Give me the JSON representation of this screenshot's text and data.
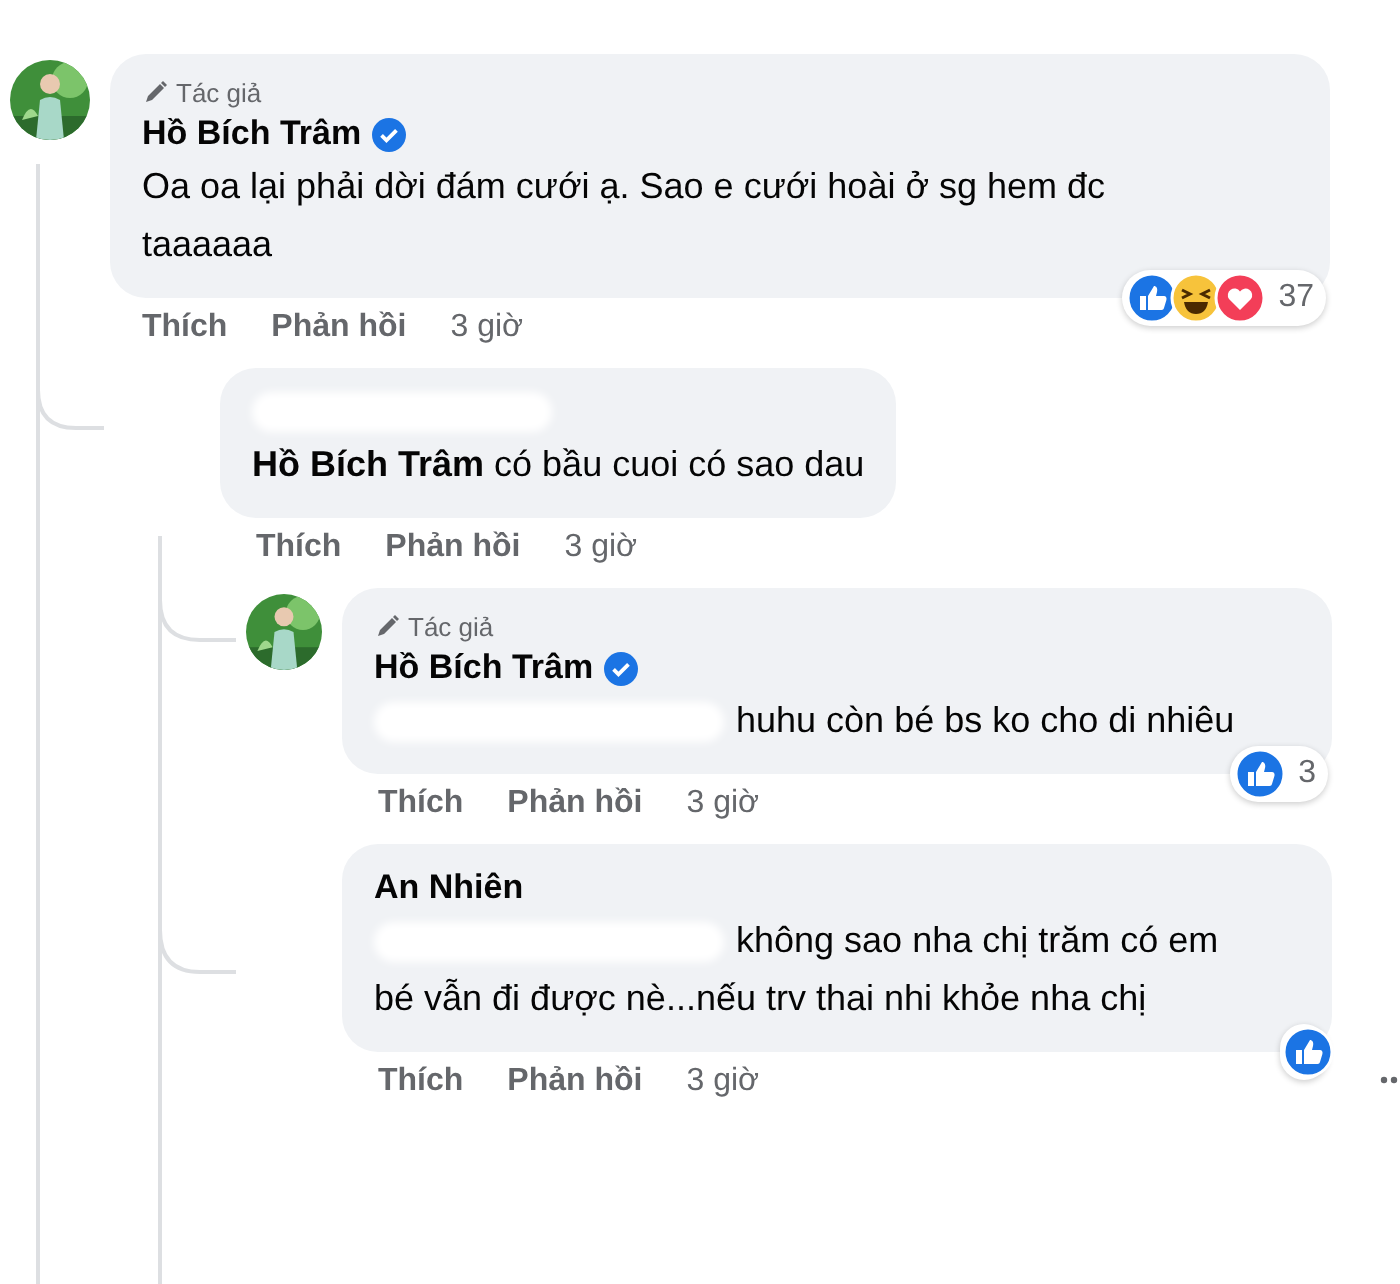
{
  "comments": [
    {
      "author_badge": "Tác giả",
      "name": "Hồ Bích Trâm",
      "verified": true,
      "avatar": {
        "kind": "picture"
      },
      "text": "Oa oa lại phải dời đám cưới ạ. Sao e cưới hoài ở sg hem đc taaaaaa",
      "actions": {
        "like": "Thích",
        "reply": "Phản hồi",
        "time": "3 giờ"
      },
      "reactions": {
        "icons": [
          {
            "kind": "like"
          },
          {
            "kind": "haha"
          },
          {
            "kind": "love"
          }
        ],
        "count": "37"
      },
      "children": [
        {
          "name_redacted": true,
          "text": "**Hồ Bích Trâm** có bầu cuoi có sao dau",
          "actions": {
            "like": "Thích",
            "reply": "Phản hồi",
            "time": "3 giờ"
          },
          "children": [
            {
              "author_badge": "Tác giả",
              "name": "Hồ Bích Trâm",
              "verified": true,
              "mention_redacted": true,
              "avatar": {
                "kind": "picture"
              },
              "text": "huhu còn bé bs ko cho di nhiêu",
              "actions": {
                "like": "Thích",
                "reply": "Phản hồi",
                "time": "3 giờ"
              },
              "reactions": {
                "icons": [
                  {
                    "kind": "like"
                  }
                ],
                "count": "3"
              }
            },
            {
              "name": "An Nhiên",
              "mention_redacted": true,
              "text": "không sao nha chị trăm có em bé vẫn đi được nè...nếu trv thai nhi khỏe nha chị",
              "actions": {
                "like": "Thích",
                "reply": "Phản hồi",
                "time": "3 giờ"
              },
              "reactions": {
                "icons": [
                  {
                    "kind": "like"
                  }
                ]
              }
            }
          ]
        }
      ]
    }
  ]
}
